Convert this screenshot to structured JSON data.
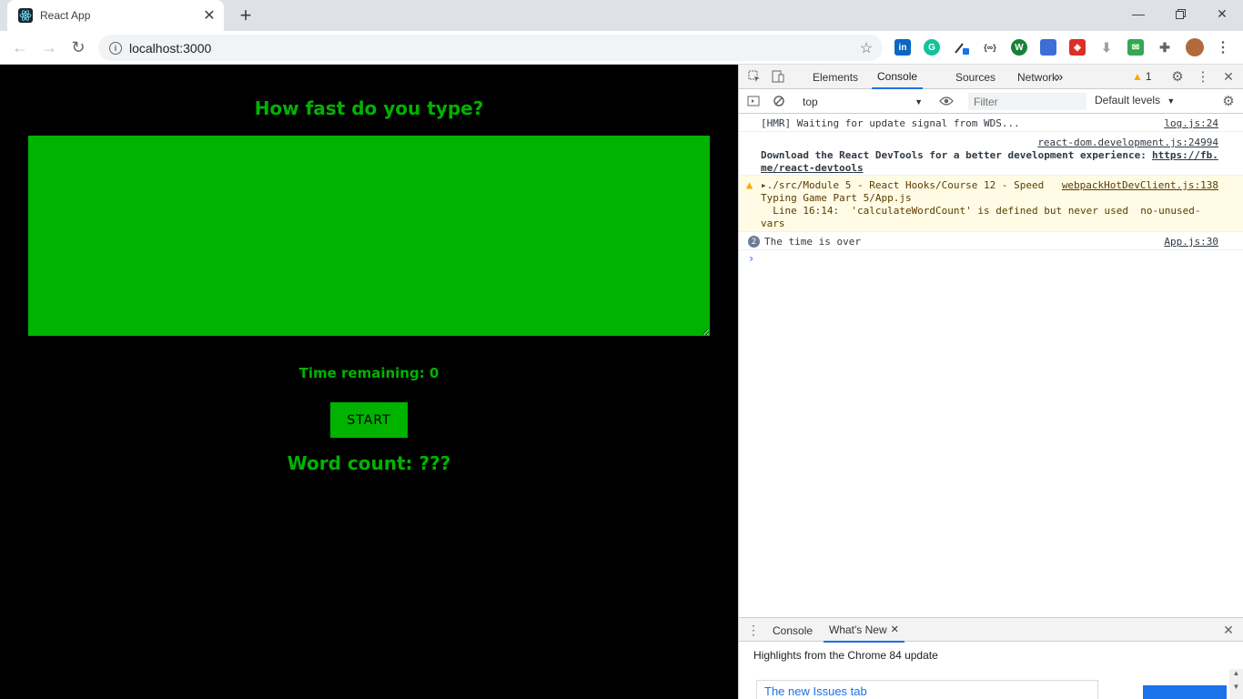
{
  "browser": {
    "tab_title": "React App",
    "url": "localhost:3000",
    "icons": {
      "favicon": "react-atom-icon",
      "tab_close": "close-icon",
      "new_tab": "plus-icon",
      "minimize": "minimize-icon",
      "maximize": "restore-icon",
      "window_close": "close-icon",
      "back": "back-arrow-icon",
      "forward": "forward-arrow-icon",
      "reload": "reload-icon",
      "site_info": "info-icon",
      "bookmark": "star-icon"
    },
    "extensions": [
      "linkedin-icon",
      "grammarly-icon",
      "eyedropper-icon",
      "json-icon",
      "extension-icon",
      "bookmark-icon",
      "shield-icon",
      "download-icon",
      "mail-icon",
      "puzzle-icon",
      "profile-avatar",
      "menu-icon"
    ]
  },
  "app": {
    "title": "How fast do you type?",
    "textarea_value": "",
    "time_remaining": "Time remaining: 0",
    "start_label": "START",
    "word_count": "Word count: ???",
    "colors": {
      "background": "#000000",
      "accent": "#00b300"
    }
  },
  "devtools": {
    "tabs": [
      "Elements",
      "Console",
      "Sources",
      "Network"
    ],
    "active_tab": "Console",
    "more_tabs": "»",
    "warning_count": "1",
    "context": "top",
    "filter_placeholder": "Filter",
    "levels": "Default levels",
    "messages": {
      "hmr": {
        "text": "[HMR] Waiting for update signal from WDS...",
        "source": "log.js:24"
      },
      "devtools_source": "react-dom.development.js:24994",
      "devtools_text": "Download the React DevTools for a better development experience:",
      "devtools_link_1": "https://fb.",
      "devtools_link_2": "me/react-devtools",
      "warn_line1": "▸./src/Module 5 - React Hooks/Course 12 - Speed",
      "warn_source": "webpackHotDevClient.js:138",
      "warn_line2": "Typing Game Part 5/App.js",
      "warn_line3": "  Line 16:14:  'calculateWordCount' is defined but never used  no-unused-",
      "warn_line4": "vars",
      "time_count": "2",
      "time_text": "The time is over",
      "time_source": "App.js:30"
    },
    "prompt": "›",
    "drawer": {
      "tabs": [
        "Console",
        "What's New"
      ],
      "active": "What's New",
      "heading": "Highlights from the Chrome 84 update",
      "card_title": "The new Issues tab"
    }
  }
}
